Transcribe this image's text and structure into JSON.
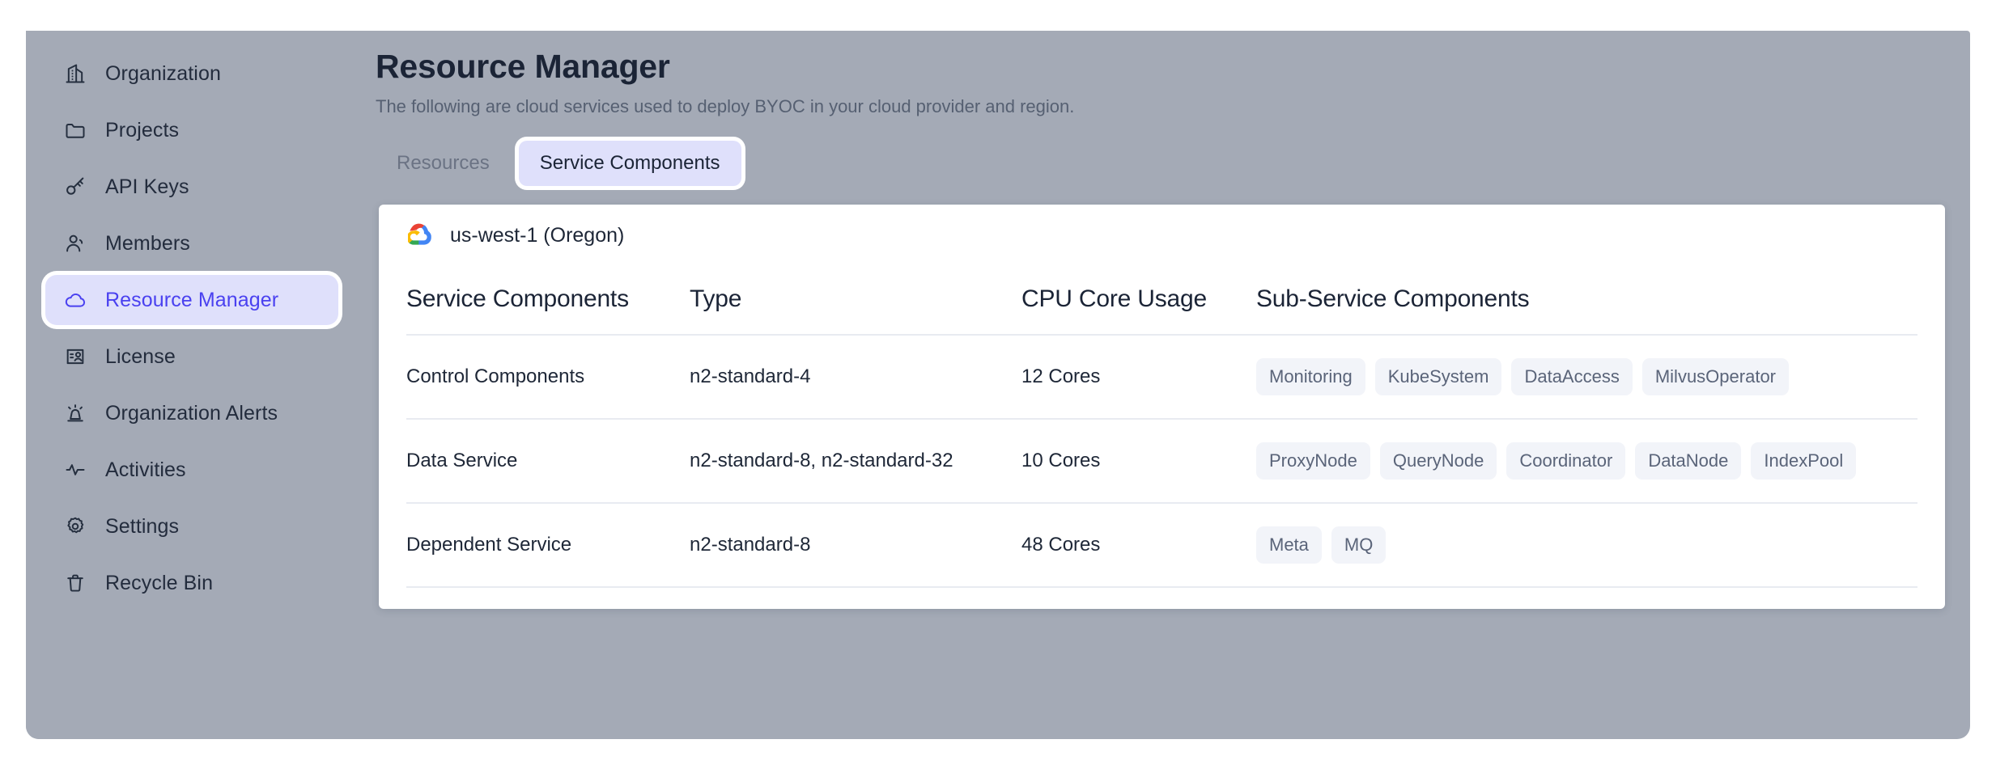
{
  "sidebar": {
    "items": [
      {
        "label": "Organization",
        "icon": "building-icon",
        "active": false
      },
      {
        "label": "Projects",
        "icon": "folder-icon",
        "active": false
      },
      {
        "label": "API Keys",
        "icon": "key-icon",
        "active": false
      },
      {
        "label": "Members",
        "icon": "user-icon",
        "active": false
      },
      {
        "label": "Resource Manager",
        "icon": "cloud-icon",
        "active": true
      },
      {
        "label": "License",
        "icon": "license-card-icon",
        "active": false
      },
      {
        "label": "Organization Alerts",
        "icon": "alert-beacon-icon",
        "active": false
      },
      {
        "label": "Activities",
        "icon": "activity-pulse-icon",
        "active": false
      },
      {
        "label": "Settings",
        "icon": "gear-icon",
        "active": false
      },
      {
        "label": "Recycle Bin",
        "icon": "trash-icon",
        "active": false
      }
    ],
    "active_color": "#4a41f0",
    "active_bg": "#dfe0fb"
  },
  "header": {
    "title": "Resource Manager",
    "subtitle": "The following are cloud services used to deploy BYOC in your cloud provider and region."
  },
  "tabs": [
    {
      "label": "Resources",
      "active": false
    },
    {
      "label": "Service Components",
      "active": true
    }
  ],
  "region_card": {
    "provider_icon": "google-cloud-icon",
    "region": "us-west-1 (Oregon)",
    "table": {
      "columns": [
        "Service Components",
        "Type",
        "CPU Core Usage",
        "Sub-Service Components"
      ],
      "rows": [
        {
          "name": "Control Components",
          "type": "n2-standard-4",
          "cpu": "12 Cores",
          "subs": [
            "Monitoring",
            "KubeSystem",
            "DataAccess",
            "MilvusOperator"
          ]
        },
        {
          "name": "Data Service",
          "type": "n2-standard-8, n2-standard-32",
          "cpu": "10 Cores",
          "subs": [
            "ProxyNode",
            "QueryNode",
            "Coordinator",
            "DataNode",
            "IndexPool"
          ]
        },
        {
          "name": "Dependent Service",
          "type": "n2-standard-8",
          "cpu": "48 Cores",
          "subs": [
            "Meta",
            "MQ"
          ]
        }
      ]
    }
  }
}
